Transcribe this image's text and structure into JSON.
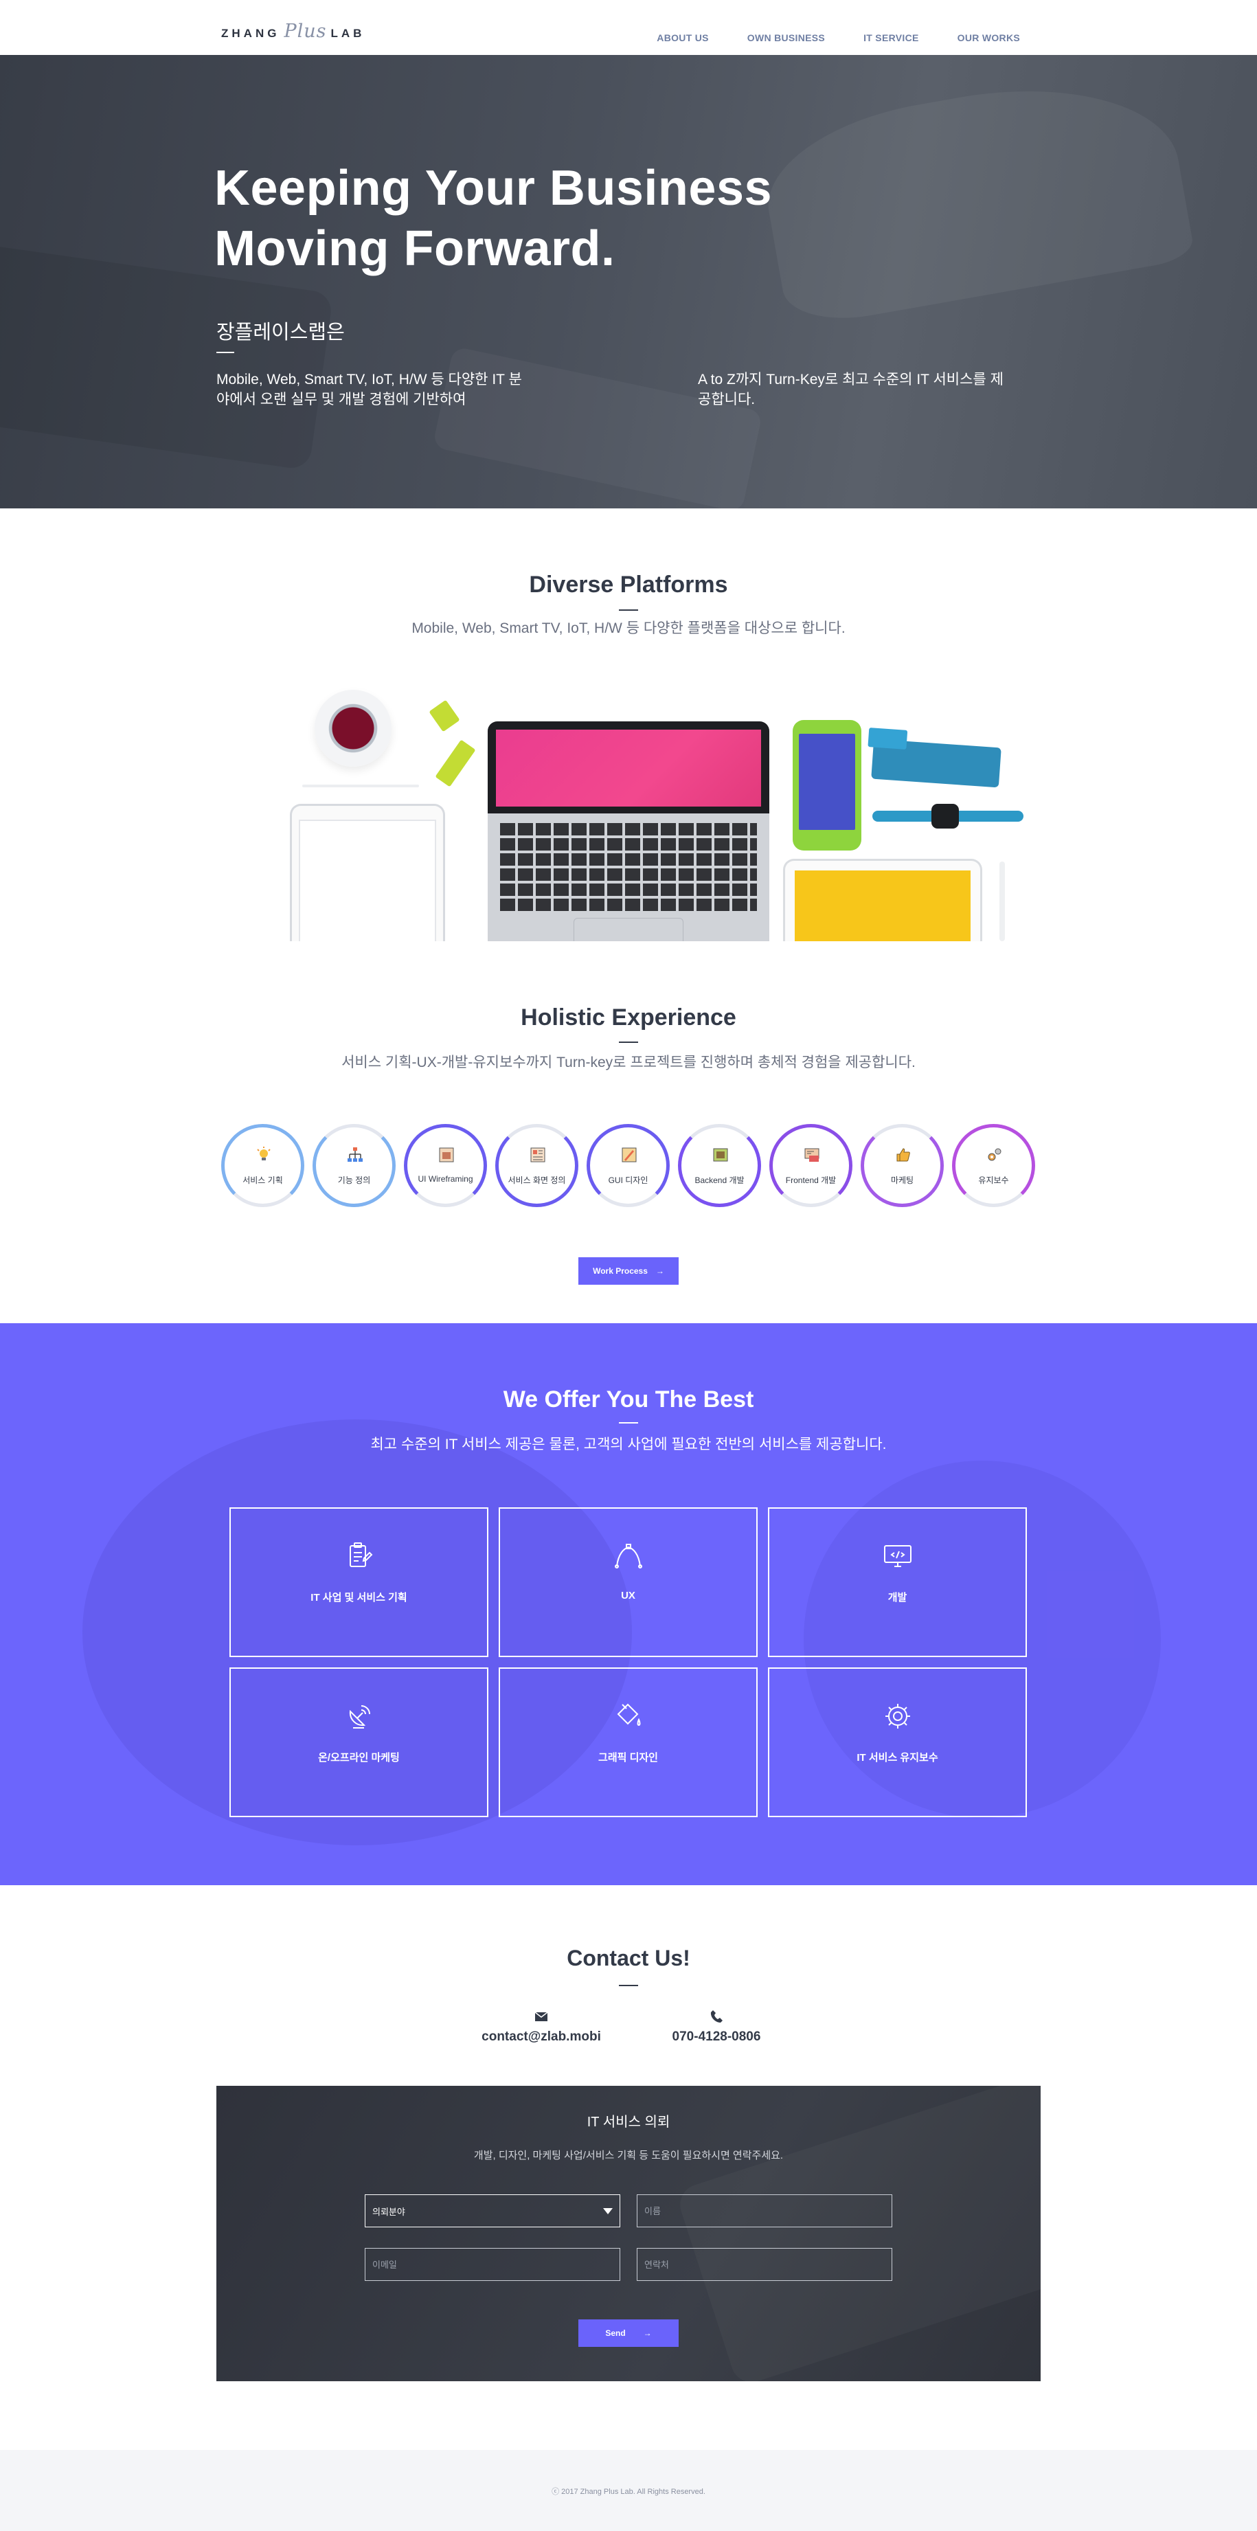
{
  "brand": {
    "logo_left": "ZHANG",
    "logo_script": "Plus",
    "logo_right": "LAB"
  },
  "nav": {
    "items": [
      "ABOUT US",
      "OWN BUSINESS",
      "IT SERVICE",
      "OUR WORKS"
    ]
  },
  "hero": {
    "title_line1": "Keeping Your Business",
    "title_line2": "Moving Forward.",
    "subtitle": "장플레이스랩은",
    "col1": "Mobile, Web, Smart TV, IoT, H/W 등 다양한 IT 분야에서 오랜 실무 및 개발 경험에 기반하여",
    "col2": "A to Z까지 Turn-Key로 최고 수준의 IT 서비스를 제공합니다."
  },
  "platforms": {
    "title": "Diverse Platforms",
    "desc": "Mobile, Web, Smart TV, IoT, H/W 등 다양한 플랫폼을 대상으로 합니다."
  },
  "experience": {
    "title": "Holistic Experience",
    "desc": "서비스 기획-UX-개발-유지보수까지 Turn-key로 프로젝트를 진행하며 총체적 경험을 제공합니다.",
    "steps": [
      {
        "label": "서비스 기획",
        "icon": "lightbulb-icon",
        "color": "#7fb2f0",
        "arc": "top"
      },
      {
        "label": "기능 정의",
        "icon": "hierarchy-icon",
        "color": "#7fb2f0",
        "arc": "bot"
      },
      {
        "label": "UI Wireframing",
        "icon": "wireframe-icon",
        "color": "#6a5cf0",
        "arc": "top"
      },
      {
        "label": "서비스 화면 정의",
        "icon": "screen-layout-icon",
        "color": "#6a5cf0",
        "arc": "bot"
      },
      {
        "label": "GUI 디자인",
        "icon": "design-pencil-icon",
        "color": "#6a5cf0",
        "arc": "top"
      },
      {
        "label": "Backend 개발",
        "icon": "server-icon",
        "color": "#7a52f0",
        "arc": "bot"
      },
      {
        "label": "Frontend 개발",
        "icon": "code-window-icon",
        "color": "#8a4ee8",
        "arc": "top"
      },
      {
        "label": "마케팅",
        "icon": "thumbs-up-icon",
        "color": "#a35be8",
        "arc": "bot"
      },
      {
        "label": "유지보수",
        "icon": "gears-icon",
        "color": "#b650e0",
        "arc": "top"
      }
    ],
    "button": "Work Process"
  },
  "offer": {
    "title": "We Offer You The Best",
    "desc": "최고 수준의 IT 서비스 제공은 물론, 고객의 사업에 필요한 전반의 서비스를 제공합니다.",
    "services": [
      {
        "label": "IT 사업 및 서비스 기획",
        "icon": "clipboard-icon"
      },
      {
        "label": "UX",
        "icon": "bezier-pen-icon"
      },
      {
        "label": "개발",
        "icon": "monitor-code-icon"
      },
      {
        "label": "온/오프라인 마케팅",
        "icon": "satellite-dish-icon"
      },
      {
        "label": "그래픽 디자인",
        "icon": "paint-bucket-icon"
      },
      {
        "label": "IT 서비스 유지보수",
        "icon": "gear-icon"
      }
    ]
  },
  "contact": {
    "title": "Contact Us!",
    "email": "contact@zlab.mobi",
    "phone": "070-4128-0806",
    "form": {
      "title": "IT 서비스 의뢰",
      "desc": "개발, 디자인, 마케팅 사업/서비스 기획 등 도움이 필요하시면 연락주세요.",
      "select_value": "의뢰분야",
      "name_placeholder": "이름",
      "email_placeholder": "이메일",
      "phone_placeholder": "연락처",
      "send": "Send"
    }
  },
  "footer": {
    "copyright": "ⓒ 2017 Zhang Plus Lab. All Rights Reserved."
  },
  "colors": {
    "accent": "#6a63fb",
    "offer_bg": "#6c65fc",
    "dark": "#333a48"
  }
}
